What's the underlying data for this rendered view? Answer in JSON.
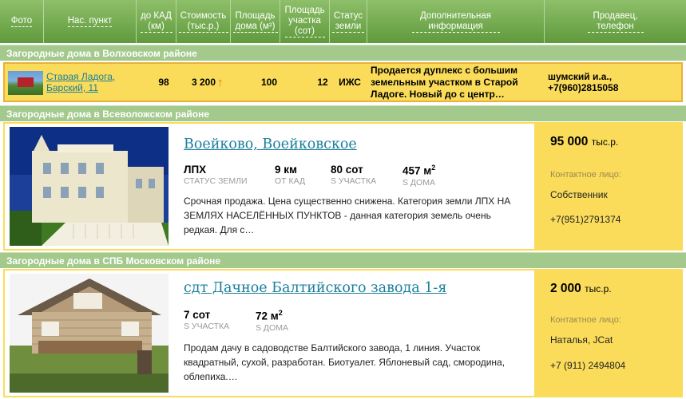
{
  "header": {
    "foto": "Фото",
    "np": "Нас. пункт",
    "kad": "до КАД (км)",
    "cost": "Стоимость (тыс.р.)",
    "area": "Площадь дома (м²)",
    "plot": "Площадь участка (сот)",
    "status": "Статус земли",
    "info": "Дополнительная информация",
    "seller": "Продавец, телефон"
  },
  "sections": [
    "Загородные дома в Волховском районе",
    "Загородные дома в Всеволожском районе",
    "Загородные дома в СПБ Московском районе"
  ],
  "compact_row": {
    "place": "Старая Ладога, Барский, 11",
    "kad": "98",
    "price": "3 200",
    "price_trend": "up",
    "area": "100",
    "plot": "12",
    "status": "ИЖС",
    "info": "Продается дуплекс с большим земельным участком в Старой Ладоге. Новый до с центр…",
    "seller_name": "шумский и.а.,",
    "seller_phone": "+7(960)2815058"
  },
  "cards": [
    {
      "title": "Воейково, Воейковское",
      "stats": [
        {
          "value": "ЛПХ",
          "label": "СТАТУС ЗЕМЛИ"
        },
        {
          "value": "9 км",
          "label": "ОТ КАД"
        },
        {
          "value": "80 сот",
          "label": "S УЧАСТКА"
        },
        {
          "value": "457 м",
          "sup": "2",
          "label": "S ДОМА"
        }
      ],
      "description": "Срочная продажа. Цена существенно снижена. Категория земли ЛПХ НА ЗЕМЛЯХ НАСЕЛЁННЫХ ПУНКТОВ - данная категория земель очень редкая. Для с…",
      "price": "95 000",
      "price_unit": "тыс.р.",
      "contact_label": "Контактное лицо:",
      "contact_name": "Собственник",
      "phone": "+7(951)2791374"
    },
    {
      "title": "сдт Дачное Балтийского завода 1-я",
      "stats": [
        {
          "value": "7 сот",
          "label": "S УЧАСТКА"
        },
        {
          "value": "72 м",
          "sup": "2",
          "label": "S ДОМА"
        }
      ],
      "description": "Продам дачу в садоводстве Балтийского завода, 1 линия. Участок квадратный, сухой, разработан. Биотуалет. Яблоневый сад, смородина, облепиха.…",
      "price": "2 000",
      "price_unit": "тыс.р.",
      "contact_label": "Контактное лицо:",
      "contact_name": "Наталья, JCat",
      "phone": "+7 (911) 2494804"
    }
  ]
}
